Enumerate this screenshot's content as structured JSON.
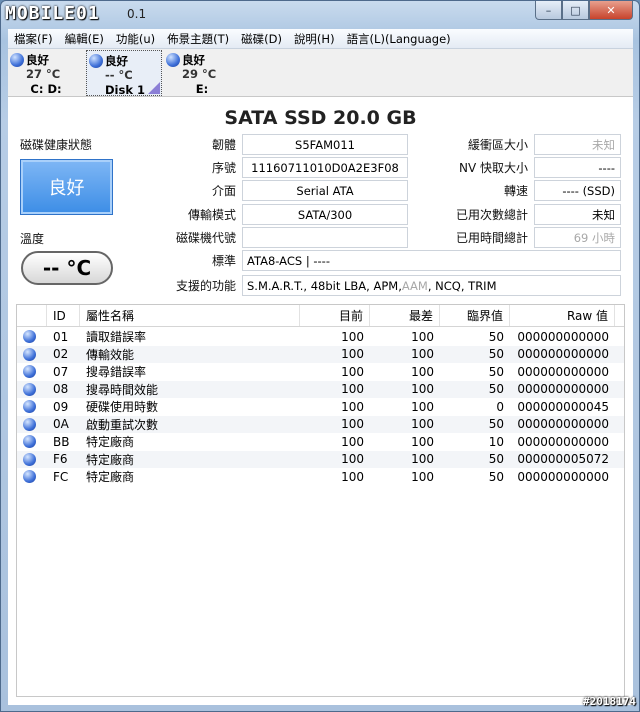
{
  "titlebar": {
    "logo": "MOBILE01",
    "version": "0.1",
    "minimize": "–",
    "maximize": "□",
    "close": "✕"
  },
  "menu": [
    "檔案(F)",
    "編輯(E)",
    "功能(u)",
    "佈景主題(T)",
    "磁碟(D)",
    "說明(H)",
    "語言(L)(Language)"
  ],
  "disks": [
    {
      "status": "良好",
      "temp": "27 °C",
      "label": "C: D:"
    },
    {
      "status": "良好",
      "temp": "-- °C",
      "label": "Disk 1"
    },
    {
      "status": "良好",
      "temp": "29 °C",
      "label": "E:"
    }
  ],
  "model": "SATA SSD  20.0 GB",
  "health": {
    "label": "磁碟健康狀態",
    "value": "良好"
  },
  "temperature": {
    "label": "溫度",
    "value": "-- °C"
  },
  "info": {
    "firmware_label": "韌體",
    "firmware": "S5FAM011",
    "serial_label": "序號",
    "serial": "11160711010D0A2E3F08",
    "interface_label": "介面",
    "interface": "Serial ATA",
    "transfer_label": "傳輸模式",
    "transfer": "SATA/300",
    "drive_letter_label": "磁碟機代號",
    "drive_letter": "",
    "standard_label": "標準",
    "standard": "ATA8-ACS | ----",
    "features_label": "支援的功能",
    "features_a": "S.M.A.R.T., 48bit LBA, APM, ",
    "features_aam": "AAM",
    "features_b": ", NCQ, TRIM",
    "buffer_label": "緩衝區大小",
    "buffer": "未知",
    "nv_cache_label": "NV 快取大小",
    "nv_cache": "----",
    "rotation_label": "轉速",
    "rotation": "---- (SSD)",
    "power_on_count_label": "已用次數總計",
    "power_on_count": "未知",
    "power_on_hours_label": "已用時間總計",
    "power_on_hours": "69 小時"
  },
  "smart": {
    "headers": [
      "",
      "ID",
      "屬性名稱",
      "目前",
      "最差",
      "臨界值",
      "Raw 值"
    ],
    "rows": [
      {
        "id": "01",
        "name": "讀取錯誤率",
        "current": "100",
        "worst": "100",
        "threshold": "50",
        "raw": "000000000000"
      },
      {
        "id": "02",
        "name": "傳輸效能",
        "current": "100",
        "worst": "100",
        "threshold": "50",
        "raw": "000000000000"
      },
      {
        "id": "07",
        "name": "搜尋錯誤率",
        "current": "100",
        "worst": "100",
        "threshold": "50",
        "raw": "000000000000"
      },
      {
        "id": "08",
        "name": "搜尋時間效能",
        "current": "100",
        "worst": "100",
        "threshold": "50",
        "raw": "000000000000"
      },
      {
        "id": "09",
        "name": "硬碟使用時數",
        "current": "100",
        "worst": "100",
        "threshold": "0",
        "raw": "000000000045"
      },
      {
        "id": "0A",
        "name": "啟動重試次數",
        "current": "100",
        "worst": "100",
        "threshold": "50",
        "raw": "000000000000"
      },
      {
        "id": "BB",
        "name": "特定廠商",
        "current": "100",
        "worst": "100",
        "threshold": "10",
        "raw": "000000000000"
      },
      {
        "id": "F6",
        "name": "特定廠商",
        "current": "100",
        "worst": "100",
        "threshold": "50",
        "raw": "000000005072"
      },
      {
        "id": "FC",
        "name": "特定廠商",
        "current": "100",
        "worst": "100",
        "threshold": "50",
        "raw": "000000000000"
      }
    ]
  },
  "watermark": "#2018174"
}
